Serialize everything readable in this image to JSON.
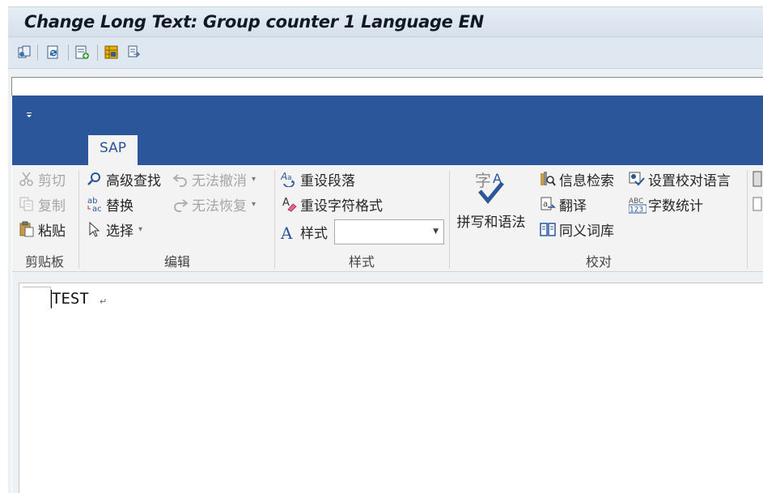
{
  "window": {
    "title": "Change Long Text: Group counter 1 Language EN"
  },
  "app_toolbar": {
    "icons": [
      "copy-document-icon",
      "refresh-icon",
      "insert-line-icon",
      "grid-icon",
      "paste-icon"
    ]
  },
  "ribbon": {
    "tab_label": "SAP",
    "clipboard": {
      "group_label": "剪贴板",
      "cut": "剪切",
      "copy": "复制",
      "paste": "粘贴"
    },
    "editing": {
      "group_label": "编辑",
      "advanced_find": "高级查找",
      "replace": "替换",
      "select": "选择",
      "undo": "无法撤消",
      "redo": "无法恢复"
    },
    "styles": {
      "group_label": "样式",
      "reset_paragraph": "重设段落",
      "reset_char_format": "重设字符格式",
      "style": "样式",
      "style_value": ""
    },
    "proofing": {
      "group_label": "校对",
      "spelling_grammar": "拼写和语法",
      "research": "信息检索",
      "translate": "翻译",
      "thesaurus": "同义词库",
      "set_language": "设置校对语言",
      "word_count": "字数统计"
    }
  },
  "document": {
    "text": "TEST"
  },
  "colors": {
    "ribbon_blue": "#2b579a",
    "ribbon_bg": "#f3f3f3"
  }
}
